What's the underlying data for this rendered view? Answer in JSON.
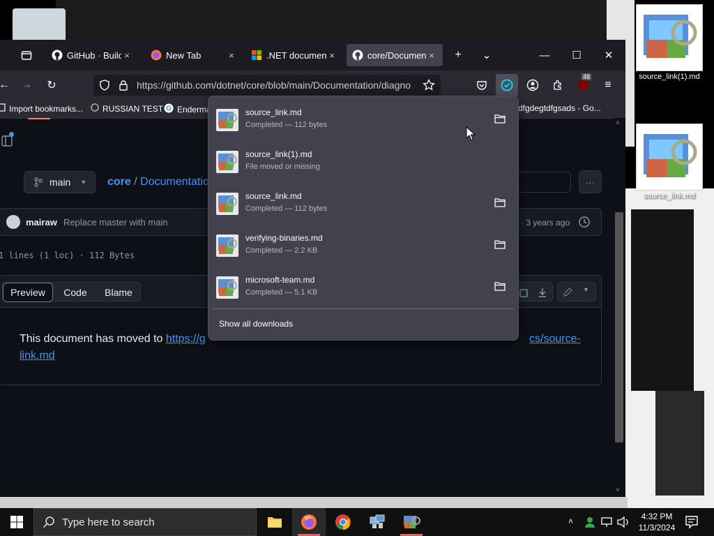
{
  "desktop": {
    "icons": [
      {
        "label": "source_link(1).md"
      },
      {
        "label": "source_link.md"
      }
    ]
  },
  "browser": {
    "tabs": [
      {
        "title": "GitHub · Build a",
        "close": "×"
      },
      {
        "title": "New Tab",
        "close": "×"
      },
      {
        "title": ".NET document",
        "close": "×"
      },
      {
        "title": "core/Document",
        "close": "×",
        "active": true
      }
    ],
    "new_tab": "+",
    "tab_list": "⌄",
    "window": {
      "minimize": "—",
      "maximize": "☐",
      "close": "✕"
    },
    "url": "https://github.com/dotnet/core/blob/main/Documentation/diagno",
    "extension_badge": "48",
    "bookmarks": [
      {
        "label": "Import bookmarks..."
      },
      {
        "label": "RUSSIAN TEST"
      },
      {
        "label": "Enderma"
      },
      {
        "label": "dfgdegtdfgsads - Go..."
      }
    ]
  },
  "github": {
    "branch": "main",
    "breadcrumb_repo": "core",
    "breadcrumb_sep": "/",
    "breadcrumb_path": "Documentatio",
    "more": "···",
    "commit_author": "mairaw",
    "commit_message": "Replace master with main",
    "commit_time": "· 3 years ago",
    "file_info": "1 lines (1 loc) · 112 Bytes",
    "view_tabs": [
      "Preview",
      "Code",
      "Blame"
    ],
    "body_text": "This document has moved to ",
    "link_part1": "https://g",
    "link_part2": "cs/source-",
    "link_part3": "link.md"
  },
  "downloads": {
    "items": [
      {
        "name": "source_link.md",
        "status": "Completed — 112 bytes",
        "has_folder": true
      },
      {
        "name": "source_link(1).md",
        "status": "File moved or missing",
        "has_folder": false
      },
      {
        "name": "source_link.md",
        "status": "Completed — 112 bytes",
        "has_folder": true
      },
      {
        "name": "verifying-binaries.md",
        "status": "Completed — 2.2 KB",
        "has_folder": true
      },
      {
        "name": "microsoft-team.md",
        "status": "Completed — 5.1 KB",
        "has_folder": true
      }
    ],
    "show_all": "Show all downloads"
  },
  "taskbar": {
    "search_placeholder": "Type here to search",
    "time": "4:32 PM",
    "date": "11/3/2024"
  },
  "colors": {
    "accent_red": "#f25c54",
    "link": "#4493f8",
    "panel": "#42414d"
  }
}
